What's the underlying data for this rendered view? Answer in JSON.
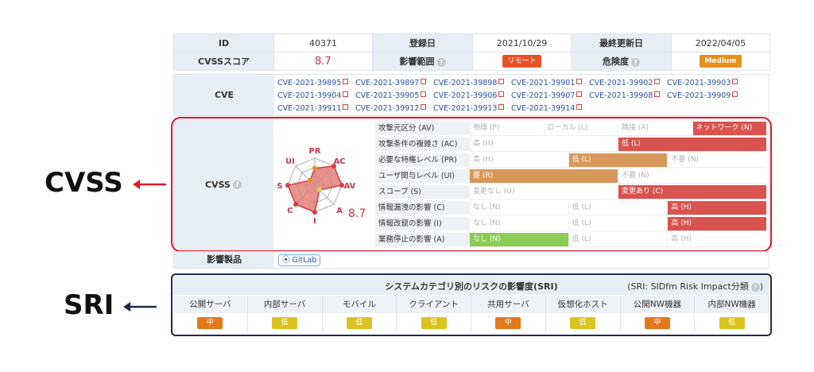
{
  "header": {
    "id_label": "ID",
    "id_value": "40371",
    "reg_label": "登録日",
    "reg_value": "2021/10/29",
    "upd_label": "最終更新日",
    "upd_value": "2022/04/05",
    "score_label": "CVSSスコア",
    "score_value": "8.7",
    "scope_label": "影響範囲",
    "scope_badge": "リモート",
    "risk_label": "危険度",
    "risk_badge": "Medium",
    "help_glyph": "?"
  },
  "cve": {
    "label": "CVE",
    "items": [
      "CVE-2021-39895",
      "CVE-2021-39897",
      "CVE-2021-39898",
      "CVE-2021-39901",
      "CVE-2021-39902",
      "CVE-2021-39903",
      "CVE-2021-39904",
      "CVE-2021-39905",
      "CVE-2021-39906",
      "CVE-2021-39907",
      "CVE-2021-39908",
      "CVE-2021-39909",
      "CVE-2021-39911",
      "CVE-2021-39912",
      "CVE-2021-39913",
      "CVE-2021-39914"
    ]
  },
  "cvss": {
    "label": "CVSS",
    "side_label": "CVSS",
    "radar_score": "8.7",
    "radar_axes": [
      "PR",
      "AC",
      "AV",
      "A",
      "I",
      "C",
      "S",
      "UI"
    ],
    "metrics": [
      {
        "name": "攻撃元区分 (AV)",
        "options": [
          "物理 (P)",
          "ローカル (L)",
          "隣接 (A)",
          "ネットワーク (N)"
        ],
        "selected": 3,
        "color": "red"
      },
      {
        "name": "攻撃条件の複雑さ (AC)",
        "options": [
          "高 (H)",
          "低 (L)"
        ],
        "selected": 1,
        "color": "red"
      },
      {
        "name": "必要な特権レベル (PR)",
        "options": [
          "高 (H)",
          "低 (L)",
          "不要 (N)"
        ],
        "selected": 1,
        "color": "brown"
      },
      {
        "name": "ユーザ関与レベル (UI)",
        "options": [
          "要 (R)",
          "不要 (N)"
        ],
        "selected": 0,
        "color": "brown"
      },
      {
        "name": "スコープ (S)",
        "options": [
          "変更なし (U)",
          "変更あり (C)"
        ],
        "selected": 1,
        "color": "red"
      },
      {
        "name": "情報漏洩の影響 (C)",
        "options": [
          "なし (N)",
          "低 (L)",
          "高 (H)"
        ],
        "selected": 2,
        "color": "red"
      },
      {
        "name": "情報改竄の影響 (I)",
        "options": [
          "なし (N)",
          "低 (L)",
          "高 (H)"
        ],
        "selected": 2,
        "color": "red"
      },
      {
        "name": "業務停止の影響 (A)",
        "options": [
          "なし (N)",
          "低 (L)",
          "高 (H)"
        ],
        "selected": 0,
        "color": "green"
      }
    ]
  },
  "product": {
    "label": "影響製品",
    "item": "GitLab"
  },
  "sri": {
    "side_label": "SRI",
    "title": "システムカテゴリ別のリスクの影響度(SRI)",
    "note": "(SRI: SIDfm Risk Impact分類",
    "columns": [
      {
        "name": "公開サーバ",
        "level": "中"
      },
      {
        "name": "内部サーバ",
        "level": "低"
      },
      {
        "name": "モバイル",
        "level": "低"
      },
      {
        "name": "クライアント",
        "level": "低"
      },
      {
        "name": "共用サーバ",
        "level": "中"
      },
      {
        "name": "仮想化ホスト",
        "level": "低"
      },
      {
        "name": "公開NW機器",
        "level": "中"
      },
      {
        "name": "内部NW機器",
        "level": "低"
      }
    ]
  },
  "colors": {
    "cvss_frame": "#e8142a",
    "sri_frame": "#1e2b4d",
    "score": "#c4394b"
  }
}
